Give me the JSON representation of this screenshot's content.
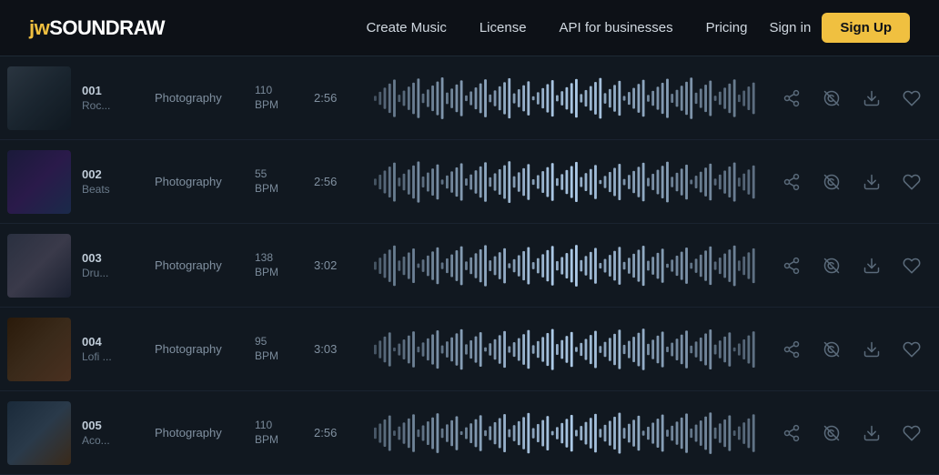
{
  "header": {
    "logo_text": "SOUNDRAW",
    "nav_items": [
      {
        "label": "Create Music",
        "href": "#"
      },
      {
        "label": "License",
        "href": "#"
      },
      {
        "label": "API for businesses",
        "href": "#"
      },
      {
        "label": "Pricing",
        "href": "#"
      }
    ],
    "signin_label": "Sign in",
    "signup_label": "Sign Up"
  },
  "tracks": [
    {
      "num": "001",
      "name": "Roc...",
      "genre": "Photography",
      "bpm": "110",
      "bpm_label": "BPM",
      "duration": "2:56",
      "thumb_class": "thumb-1"
    },
    {
      "num": "002",
      "name": "Beats",
      "genre": "Photography",
      "bpm": "55",
      "bpm_label": "BPM",
      "duration": "2:56",
      "thumb_class": "thumb-2"
    },
    {
      "num": "003",
      "name": "Dru...",
      "genre": "Photography",
      "bpm": "138",
      "bpm_label": "BPM",
      "duration": "3:02",
      "thumb_class": "thumb-3"
    },
    {
      "num": "004",
      "name": "Lofi ...",
      "genre": "Photography",
      "bpm": "95",
      "bpm_label": "BPM",
      "duration": "3:03",
      "thumb_class": "thumb-4"
    },
    {
      "num": "005",
      "name": "Aco...",
      "genre": "Photography",
      "bpm": "110",
      "bpm_label": "BPM",
      "duration": "2:56",
      "thumb_class": "thumb-5"
    }
  ]
}
